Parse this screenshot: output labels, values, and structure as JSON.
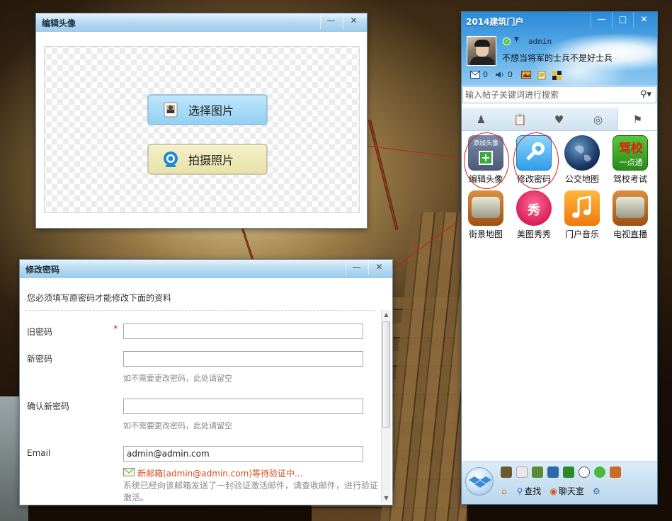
{
  "avatar_window": {
    "title": "编辑头像",
    "choose_label": "选择图片",
    "shoot_label": "拍摄照片",
    "minimize": "—",
    "close": "✕"
  },
  "password_window": {
    "title": "修改密码",
    "tip": "您必须填写原密码才能修改下面的资料",
    "old_label": "旧密码",
    "new_label": "新密码",
    "confirm_label": "确认新密码",
    "email_label": "Email",
    "required_mark": "*",
    "new_hint": "如不需要更改密码，此处请留空",
    "confirm_hint": "如不需要更改密码，此处请留空",
    "email_value": "admin@admin.com",
    "email_pending": "新邮箱(admin@admin.com)等待验证中...",
    "email_note": "系统已经向该邮箱发送了一封验证激活邮件，请查收邮件，进行验证激活。",
    "minimize": "—",
    "close": "✕"
  },
  "portal": {
    "title": "2014建筑门户",
    "username": "admin",
    "motto": "不想当将军的士兵不是好士兵",
    "mail_count": "0",
    "notice_count": "0",
    "search_placeholder": "输入帖子关键词进行搜索",
    "minimize": "—",
    "maximize": "□",
    "close": "✕",
    "apps": [
      {
        "label": "编辑头像",
        "icon": "add-avatar-icon",
        "badge": "添加头像"
      },
      {
        "label": "修改密码",
        "icon": "key-icon"
      },
      {
        "label": "公交地图",
        "icon": "globe-icon"
      },
      {
        "label": "驾校考试",
        "icon": "driving-school-icon",
        "badge": "驾校",
        "badge2": "一点通"
      },
      {
        "label": "街景地图",
        "icon": "tv-icon"
      },
      {
        "label": "美图秀秀",
        "icon": "meitu-icon",
        "badge": "秀"
      },
      {
        "label": "门户音乐",
        "icon": "music-icon"
      },
      {
        "label": "电视直播",
        "icon": "tv-live-icon"
      }
    ],
    "bottom_find": "查找",
    "bottom_chat": "聊天室"
  },
  "colors": {
    "accent_blue": "#2b8ad8",
    "required_red": "#e02020",
    "pending_orange": "#d6501e",
    "annotation_red": "#d02020"
  }
}
